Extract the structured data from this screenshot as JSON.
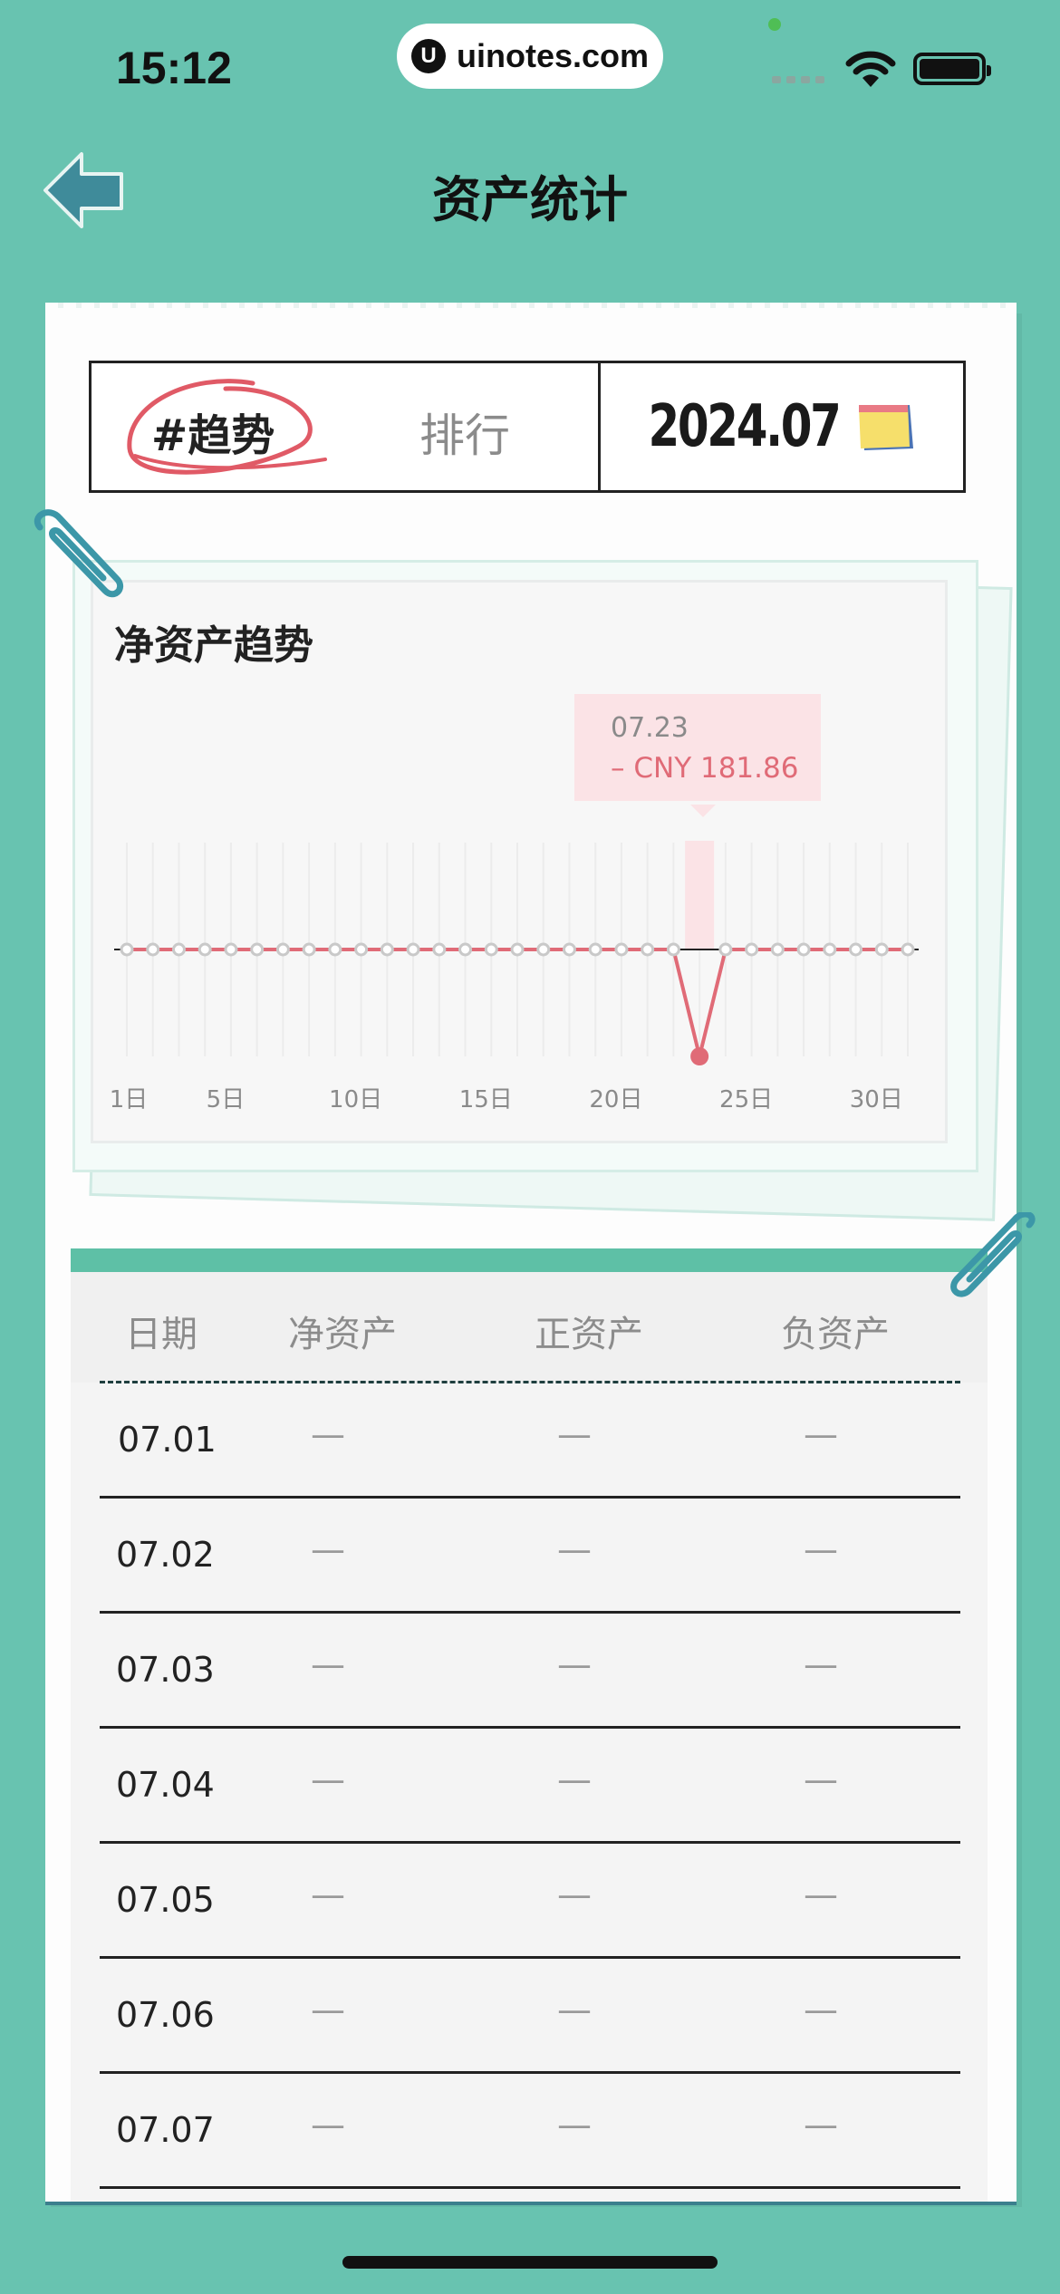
{
  "status_bar": {
    "time": "15:12",
    "url": "uinotes.com",
    "logo_letter": "U"
  },
  "header": {
    "title": "资产统计",
    "back_icon": "arrow-left-icon"
  },
  "tabs": {
    "trend_label": "#趋势",
    "rank_label": "排行",
    "month": "2024.07",
    "calendar_icon": "calendar-icon"
  },
  "chart": {
    "title": "净资产趋势",
    "tooltip_date": "07.23",
    "tooltip_value": "– CNY 181.86",
    "line_color": "#e06b77",
    "accent_bg": "#fbe3e6"
  },
  "chart_data": {
    "type": "line",
    "x": [
      1,
      2,
      3,
      4,
      5,
      6,
      7,
      8,
      9,
      10,
      11,
      12,
      13,
      14,
      15,
      16,
      17,
      18,
      19,
      20,
      21,
      22,
      23,
      24,
      25,
      26,
      27,
      28,
      29,
      30,
      31
    ],
    "y": [
      0,
      0,
      0,
      0,
      0,
      0,
      0,
      0,
      0,
      0,
      0,
      0,
      0,
      0,
      0,
      0,
      0,
      0,
      0,
      0,
      0,
      0,
      -181.86,
      0,
      0,
      0,
      0,
      0,
      0,
      0,
      0
    ],
    "x_tick_labels": [
      "1日",
      "5日",
      "10日",
      "15日",
      "20日",
      "25日",
      "30日"
    ],
    "x_tick_values": [
      1,
      5,
      10,
      15,
      20,
      25,
      30
    ],
    "highlight_index": 22,
    "grid": true
  },
  "table": {
    "columns": [
      "日期",
      "净资产",
      "正资产",
      "负资产"
    ],
    "rows": [
      {
        "date": "07.01",
        "net": "—",
        "pos": "—",
        "neg": "—"
      },
      {
        "date": "07.02",
        "net": "—",
        "pos": "—",
        "neg": "—"
      },
      {
        "date": "07.03",
        "net": "—",
        "pos": "—",
        "neg": "—"
      },
      {
        "date": "07.04",
        "net": "—",
        "pos": "—",
        "neg": "—"
      },
      {
        "date": "07.05",
        "net": "—",
        "pos": "—",
        "neg": "—"
      },
      {
        "date": "07.06",
        "net": "—",
        "pos": "—",
        "neg": "—"
      },
      {
        "date": "07.07",
        "net": "—",
        "pos": "—",
        "neg": "—"
      }
    ]
  }
}
